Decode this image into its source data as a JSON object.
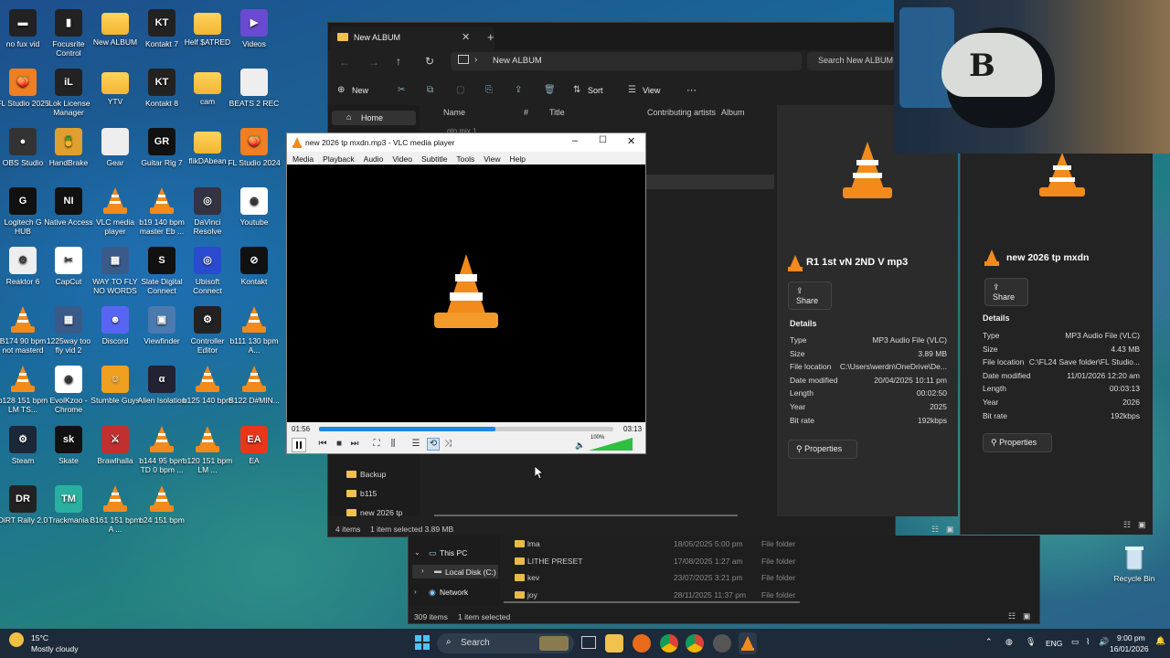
{
  "desktop": {
    "icons": [
      {
        "label": "no fux vid",
        "kind": "clapper"
      },
      {
        "label": "Focusrite Control",
        "kind": "bars"
      },
      {
        "label": "New ALBUM",
        "kind": "folder"
      },
      {
        "label": "Kontakt 7",
        "kind": "kt"
      },
      {
        "label": "Helf $ATRED",
        "kind": "folder"
      },
      {
        "label": "Videos",
        "kind": "video"
      },
      {
        "label": "FL Studio 2025",
        "kind": "fl"
      },
      {
        "label": "iLok License Manager",
        "kind": "ilok"
      },
      {
        "label": "YTV",
        "kind": "folder"
      },
      {
        "label": "Kontakt 8",
        "kind": "kt"
      },
      {
        "label": "cam",
        "kind": "folder"
      },
      {
        "label": "BEATS 2 REC",
        "kind": "doc"
      },
      {
        "label": "OBS Studio",
        "kind": "obs"
      },
      {
        "label": "HandBrake",
        "kind": "hb"
      },
      {
        "label": "Gear",
        "kind": "doc"
      },
      {
        "label": "Guitar Rig 7",
        "kind": "gr"
      },
      {
        "label": "flikDAbean",
        "kind": "folder"
      },
      {
        "label": "FL Studio 2024",
        "kind": "fl"
      },
      {
        "label": "Logitech G HUB",
        "kind": "g"
      },
      {
        "label": "Native Access",
        "kind": "ni"
      },
      {
        "label": "VLC media player",
        "kind": "vlc"
      },
      {
        "label": "b19 140 bpm master Eb ...",
        "kind": "vlc"
      },
      {
        "label": "DaVinci Resolve",
        "kind": "dv"
      },
      {
        "label": "Youtube",
        "kind": "chrome"
      },
      {
        "label": "Reaktor 6",
        "kind": "reaktor"
      },
      {
        "label": "CapCut",
        "kind": "capcut"
      },
      {
        "label": "WAY TO FLY NO WORDS",
        "kind": "img"
      },
      {
        "label": "Slate Digital Connect",
        "kind": "slate"
      },
      {
        "label": "Ubisoft Connect",
        "kind": "ubi"
      },
      {
        "label": "Kontakt",
        "kind": "kontakt"
      },
      {
        "label": "B174 90 bpm not masterd",
        "kind": "vlc"
      },
      {
        "label": "1225way too fly vid 2",
        "kind": "img"
      },
      {
        "label": "Discord",
        "kind": "discord"
      },
      {
        "label": "Viewfinder",
        "kind": "vf"
      },
      {
        "label": "Controller Editor",
        "kind": "ce"
      },
      {
        "label": "b111 130 bpm A...",
        "kind": "vlc"
      },
      {
        "label": "b128 151 bpm LM TS...",
        "kind": "vlc"
      },
      {
        "label": "EvolKzoo - Chrome",
        "kind": "chrome"
      },
      {
        "label": "Stumble Guys",
        "kind": "sg"
      },
      {
        "label": "Alien Isolation",
        "kind": "alien"
      },
      {
        "label": "b125 140 bpm",
        "kind": "vlc"
      },
      {
        "label": "B122 D#MIN...",
        "kind": "vlc"
      },
      {
        "label": "Steam",
        "kind": "steam"
      },
      {
        "label": "Skate",
        "kind": "skate"
      },
      {
        "label": "Brawlhalla",
        "kind": "brawl"
      },
      {
        "label": "b144 95 bpm TD 0 bpm ...",
        "kind": "vlc"
      },
      {
        "label": "b120 151 bpm LM ...",
        "kind": "vlc"
      },
      {
        "label": "EA",
        "kind": "ea"
      },
      {
        "label": "DiRT Rally 2.0",
        "kind": "dirt"
      },
      {
        "label": "Trackmania",
        "kind": "tm"
      },
      {
        "label": "B161 151 bpm A ...",
        "kind": "vlc"
      },
      {
        "label": "b24 151 bpm",
        "kind": "vlc"
      }
    ],
    "recycle_bin": "Recycle Bin"
  },
  "explorer": {
    "tab_title": "New ALBUM",
    "address": "New ALBUM",
    "search_placeholder": "Search New ALBUM",
    "toolbar": {
      "new": "New",
      "sort": "Sort",
      "view": "View"
    },
    "nav_home": "Home",
    "columns": [
      "Name",
      "#",
      "Title",
      "Contributing artists",
      "Album"
    ],
    "partial_row": "gtp mix 1",
    "nav_folders": [
      "Backup",
      "b115",
      "new 2026 tp"
    ],
    "status": {
      "items": "4 items",
      "selected": "1 item selected  3.89 MB"
    },
    "details_a": {
      "name": "R1 1st vN 2ND V mp3",
      "share": "Share",
      "section": "Details",
      "rows": [
        {
          "k": "Type",
          "v": "MP3 Audio File (VLC)"
        },
        {
          "k": "Size",
          "v": "3.89 MB"
        },
        {
          "k": "File location",
          "v": "C:\\Users\\werdn\\OneDrive\\De..."
        },
        {
          "k": "Date modified",
          "v": "20/04/2025 10:11 pm"
        },
        {
          "k": "Length",
          "v": "00:02:50"
        },
        {
          "k": "Year",
          "v": "2025"
        },
        {
          "k": "Bit rate",
          "v": "192kbps"
        }
      ],
      "properties": "Properties"
    },
    "details_b": {
      "name": "new 2026 tp mxdn",
      "share": "Share",
      "section": "Details",
      "rows": [
        {
          "k": "Type",
          "v": "MP3 Audio File (VLC)"
        },
        {
          "k": "Size",
          "v": "4.43 MB"
        },
        {
          "k": "File location",
          "v": "C:\\FL24 Save folder\\FL Studio..."
        },
        {
          "k": "Date modified",
          "v": "11/01/2026 12:20 am"
        },
        {
          "k": "Length",
          "v": "00:03:13"
        },
        {
          "k": "Year",
          "v": "2026"
        },
        {
          "k": "Bit rate",
          "v": "192kbps"
        }
      ],
      "properties": "Properties"
    }
  },
  "explorer2": {
    "tree": [
      "This PC",
      "Local Disk (C:)",
      "Network"
    ],
    "rows": [
      {
        "name": "lma",
        "date": "18/05/2025 5:00 pm",
        "type": "File folder"
      },
      {
        "name": "LITHE PRESET",
        "date": "17/08/2025 1:27 am",
        "type": "File folder"
      },
      {
        "name": "kev",
        "date": "23/07/2025 3:21 pm",
        "type": "File folder"
      },
      {
        "name": "joy",
        "date": "28/11/2025 11:37 pm",
        "type": "File folder"
      }
    ],
    "status": {
      "items": "309 items",
      "selected": "1 item selected"
    }
  },
  "vlc": {
    "title": "new 2026 tp mxdn.mp3 - VLC media player",
    "menu": [
      "Media",
      "Playback",
      "Audio",
      "Video",
      "Subtitle",
      "Tools",
      "View",
      "Help"
    ],
    "elapsed": "01:56",
    "total": "03:13",
    "progress": 0.6,
    "volume": "100%",
    "volume_level": 1.0
  },
  "taskbar": {
    "weather_temp": "15°C",
    "weather_desc": "Mostly cloudy",
    "search": "Search",
    "lang": "ENG",
    "time": "9:00 pm",
    "date": "16/01/2026"
  }
}
